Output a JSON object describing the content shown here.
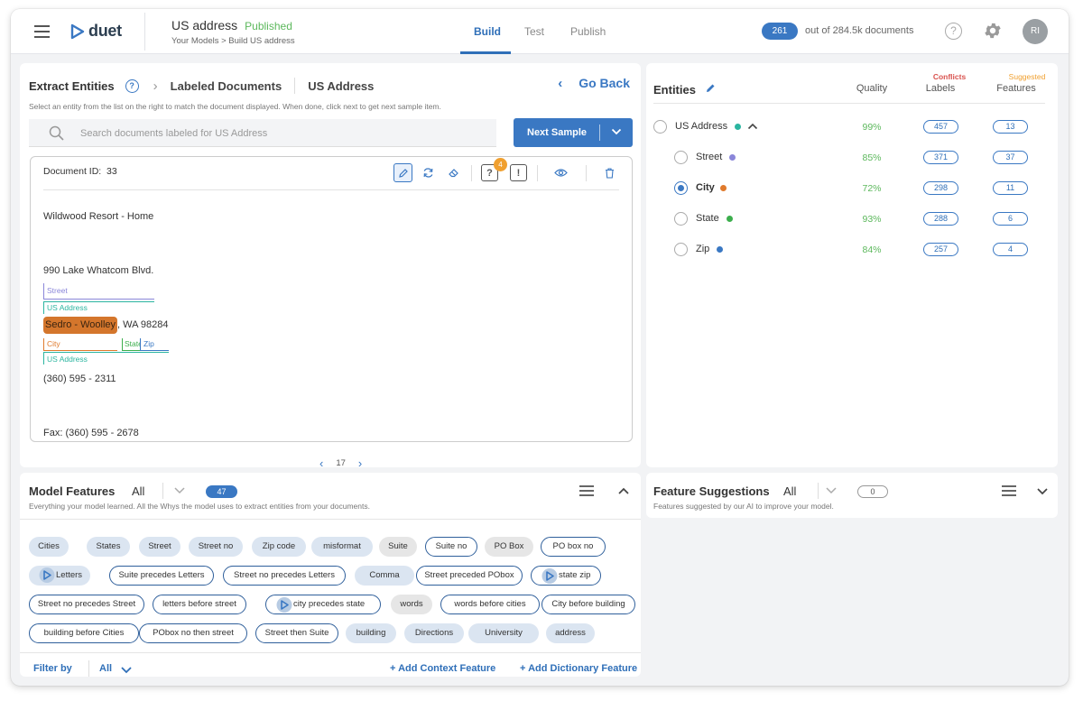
{
  "header": {
    "logo_text": "duet",
    "model_name": "US address",
    "model_status": "Published",
    "breadcrumb": "Your Models > Build US address",
    "tabs": [
      {
        "label": "Build",
        "active": true
      },
      {
        "label": "Test",
        "active": false
      },
      {
        "label": "Publish",
        "active": false
      }
    ],
    "doc_count": "261",
    "doc_count_suffix": "out of 284.5k documents",
    "help_icon": "?",
    "avatar_initials": "RI"
  },
  "extract": {
    "title": "Extract Entities",
    "help_icon": "?",
    "crumb_labeled": "Labeled Documents",
    "crumb_doc": "US Address",
    "go_back": "Go Back",
    "description": "Select an entity from the list on the right to match the document displayed. When done, click next to get next sample item.",
    "search_placeholder": "Search documents labeled for US Address",
    "next_sample": "Next Sample",
    "document": {
      "id_label": "Document ID:",
      "id_value": "33",
      "tool_badge": "4",
      "tool_help": "?",
      "tool_flag": "!",
      "line1": "Wildwood Resort - Home",
      "line2": "990 Lake Whatcom Blvd.",
      "label_street": "Street",
      "label_usaddress_1": "US Address",
      "highlight_city": "Sedro - Woolley",
      "line3_rest": ", WA 98284",
      "label_city": "City",
      "label_state": "State",
      "label_zip": "Zip",
      "label_usaddress_2": "US Address",
      "line4": "(360) 595 - 2311",
      "line5": "Fax: (360) 595 - 2678"
    },
    "page": "17"
  },
  "entities": {
    "title": "Entities",
    "col_quality": "Quality",
    "col_labels": "Labels",
    "col_features": "Features",
    "tag_conflicts": "Conflicts",
    "tag_suggested": "Suggested",
    "rows": [
      {
        "name": "US Address",
        "color": "#2bb5a0",
        "quality": "99%",
        "labels": "457",
        "features": "13",
        "selected": false
      },
      {
        "name": "Street",
        "color": "#8a86d9",
        "quality": "85%",
        "labels": "371",
        "features": "37",
        "selected": false
      },
      {
        "name": "City",
        "color": "#e07a2c",
        "quality": "72%",
        "labels": "298",
        "features": "11",
        "selected": true
      },
      {
        "name": "State",
        "color": "#3cae4d",
        "quality": "93%",
        "labels": "288",
        "features": "6",
        "selected": false
      },
      {
        "name": "Zip",
        "color": "#3a78c3",
        "quality": "84%",
        "labels": "257",
        "features": "4",
        "selected": false
      }
    ]
  },
  "features": {
    "title": "Model Features",
    "filter_value": "All",
    "count": "47",
    "description": "Everything your model learned. All the Whys the model uses to extract entities from your documents.",
    "chips": [
      {
        "label": "Cities",
        "style": "f"
      },
      {
        "label": "States",
        "style": "f"
      },
      {
        "label": "Street",
        "style": "f"
      },
      {
        "label": "Street no",
        "style": "f"
      },
      {
        "label": "Zip code",
        "style": "f"
      },
      {
        "label": "misformat",
        "style": "f"
      },
      {
        "label": "Suite",
        "style": "g"
      },
      {
        "label": "Suite no",
        "style": "o"
      },
      {
        "label": "PO Box",
        "style": "g"
      },
      {
        "label": "PO box no",
        "style": "o"
      },
      {
        "label": "Letters",
        "style": "f",
        "icon": true
      },
      {
        "label": "Suite precedes Letters",
        "style": "o"
      },
      {
        "label": "Street no precedes Letters",
        "style": "o"
      },
      {
        "label": "Comma",
        "style": "f"
      },
      {
        "label": "Street preceded PObox",
        "style": "o"
      },
      {
        "label": "state zip",
        "style": "o",
        "icon": true
      },
      {
        "label": "Street no precedes Street",
        "style": "o"
      },
      {
        "label": "letters before street",
        "style": "o"
      },
      {
        "label": "city precedes state",
        "style": "o",
        "icon": true
      },
      {
        "label": "words",
        "style": "g"
      },
      {
        "label": "words before cities",
        "style": "o"
      },
      {
        "label": "City before building",
        "style": "o"
      },
      {
        "label": "building before Cities",
        "style": "o"
      },
      {
        "label": "PObox no then street",
        "style": "o"
      },
      {
        "label": "Street then Suite",
        "style": "o"
      },
      {
        "label": "building",
        "style": "f"
      },
      {
        "label": "Directions",
        "style": "f"
      },
      {
        "label": "University",
        "style": "f"
      },
      {
        "label": "address",
        "style": "f"
      }
    ],
    "filter_by": "Filter by",
    "filter_by_value": "All",
    "add_context": "+ Add Context Feature",
    "add_dictionary": "+ Add Dictionary Feature"
  },
  "suggestions": {
    "title": "Feature Suggestions",
    "filter_value": "All",
    "count": "0",
    "description": "Features suggested by our AI to improve your model."
  },
  "colors": {
    "accent": "#3a78c3",
    "published": "#5cb85c",
    "conflicts": "#d9534f",
    "suggested": "#f0a030",
    "city_highlight": "#d4762c"
  }
}
